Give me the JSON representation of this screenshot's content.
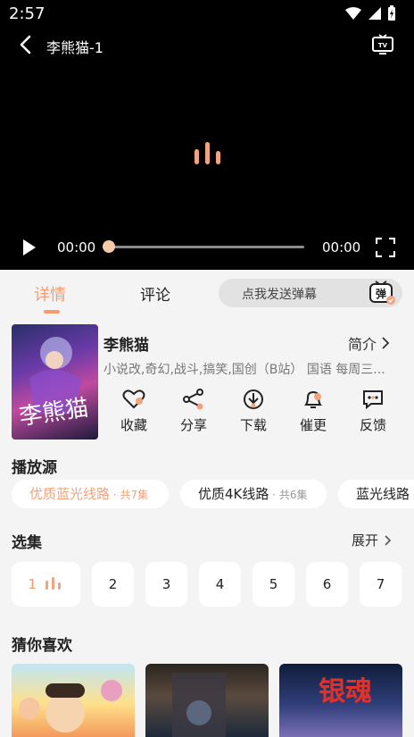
{
  "status": {
    "time": "2:57"
  },
  "player": {
    "title": "李熊猫-1",
    "current_time": "00:00",
    "total_time": "00:00",
    "progress_fraction": 0
  },
  "tabs": {
    "detail": "详情",
    "comment": "评论"
  },
  "danmu": {
    "placeholder": "点我发送弹幕",
    "button_label": "弹"
  },
  "show": {
    "title": "李熊猫",
    "intro_label": "简介",
    "tags": "小说改,奇幻,战斗,搞笑,国创（B站） 国语 每周三...",
    "cover_text": "李熊猫",
    "actions": [
      "收藏",
      "分享",
      "下载",
      "催更",
      "反馈"
    ]
  },
  "sources": {
    "title": "播放源",
    "items": [
      {
        "name": "优质蓝光线路",
        "count": " · 共7集"
      },
      {
        "name": "优质4K线路",
        "count": " · 共6集"
      },
      {
        "name": "蓝光线路",
        "count": ""
      }
    ]
  },
  "episodes": {
    "title": "选集",
    "expand_label": "展开",
    "items": [
      "1",
      "2",
      "3",
      "4",
      "5",
      "6",
      "7"
    ]
  },
  "recommend": {
    "title": "猜你喜欢",
    "third_mark": "银魂"
  },
  "colors": {
    "accent": "#f29c73",
    "player_bg": "#000000",
    "page_bg": "#f4f4f4"
  }
}
